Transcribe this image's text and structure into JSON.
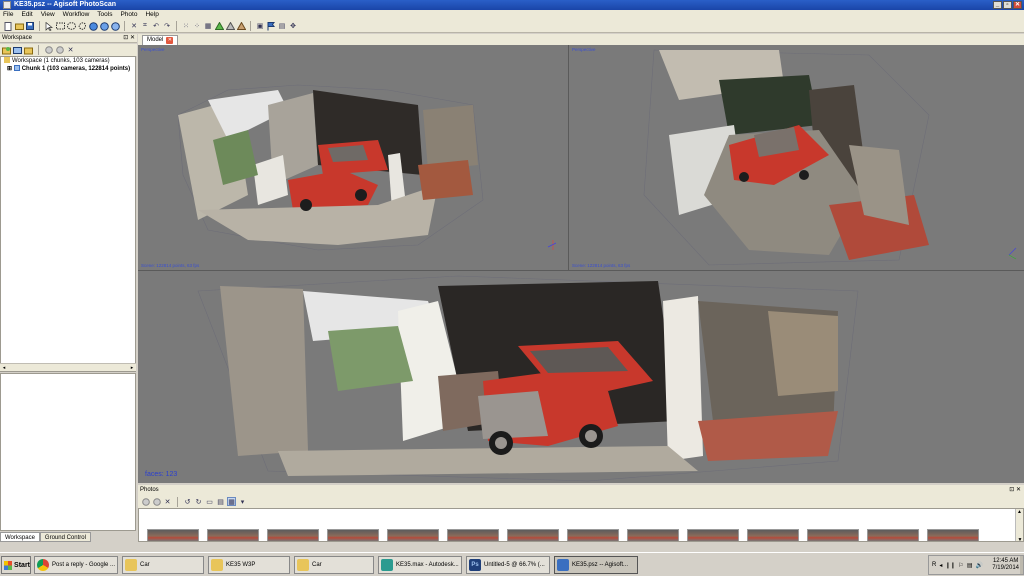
{
  "window": {
    "title": "KE35.psz -- Agisoft PhotoScan",
    "controls": [
      "_",
      "▫",
      "✕"
    ]
  },
  "menu": [
    "File",
    "Edit",
    "View",
    "Workflow",
    "Tools",
    "Photo",
    "Help"
  ],
  "workspace": {
    "title": "Workspace",
    "tree_root": "Workspace (1 chunks, 103 cameras)",
    "tree_chunk": "Chunk 1 (103 cameras, 122814 points)",
    "expander": "⊞",
    "tabs": [
      "Workspace",
      "Ground Control"
    ]
  },
  "model_tab": {
    "label": "Model",
    "close": "✕"
  },
  "viewports": {
    "top_left": {
      "label": "Perspective",
      "status": "Scene: 122814 points, 63 fps"
    },
    "top_right": {
      "label": "Perspective",
      "status": "Scene: 122814 points, 63 fps"
    },
    "bottom": {
      "status": "faces: 123"
    }
  },
  "photos": {
    "title": "Photos",
    "scroll_up": "▲",
    "scroll_down": "▼"
  },
  "panel_buttons": "⊡ ✕",
  "taskbar": {
    "start": "Start",
    "tasks": [
      {
        "label": "Post a reply - Google ...",
        "color": "#e9a227"
      },
      {
        "label": "Car",
        "color": "#e8c55a"
      },
      {
        "label": "KE35 W3P",
        "color": "#e8c55a"
      },
      {
        "label": "Car",
        "color": "#e8c55a"
      },
      {
        "label": "KE35.max - Autodesk...",
        "color": "#2c9b90"
      },
      {
        "label": "Untitled-5 @ 66.7% (...",
        "color": "#1f3f7a"
      },
      {
        "label": "KE35.psz -- Agisoft...",
        "color": "#3a6fc0"
      }
    ],
    "tray_icons": [
      "R",
      "◂",
      "❙❙",
      "⚐",
      "▤",
      "🔊"
    ],
    "time": "12:45 AM",
    "date": "7/19/2014"
  },
  "colors": {
    "car": "#c8382c",
    "titlebar": "#1f4fb5",
    "viewport_bg": "#7a7a7a"
  }
}
